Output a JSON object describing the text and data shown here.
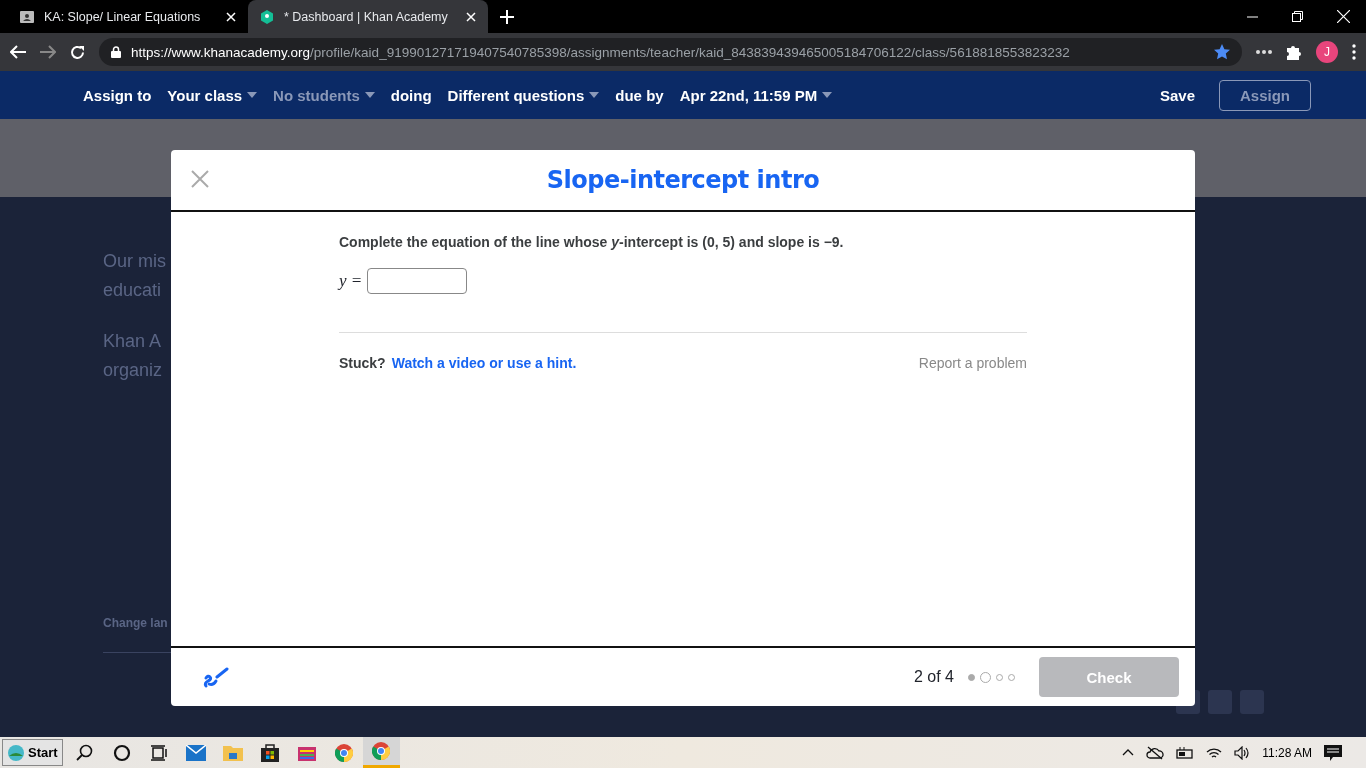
{
  "browser": {
    "tabs": [
      {
        "title": "KA: Slope/ Linear Equations",
        "selected": false
      },
      {
        "title": "* Dashboard | Khan Academy",
        "selected": true
      }
    ],
    "url_host": "https://www.khanacademy.org",
    "url_path": "/profile/kaid_919901271719407540785398/assignments/teacher/kaid_843839439465005184706122/class/5618818553823232",
    "bookmarked": true,
    "profile_initial": "J"
  },
  "assign_bar": {
    "items": [
      {
        "kind": "label",
        "text": "Assign to",
        "disabled": false
      },
      {
        "kind": "dropdown",
        "text": "Your class",
        "disabled": false
      },
      {
        "kind": "dropdown",
        "text": "No students",
        "disabled": true
      },
      {
        "kind": "label",
        "text": "doing",
        "disabled": false
      },
      {
        "kind": "dropdown",
        "text": "Different questions",
        "disabled": false
      },
      {
        "kind": "label",
        "text": "due by",
        "disabled": false
      },
      {
        "kind": "dropdown",
        "text": "Apr 22nd, 11:59 PM",
        "disabled": false
      }
    ],
    "save": "Save",
    "assign": {
      "label": "Assign",
      "disabled": true
    }
  },
  "background_page": {
    "paragraphs": [
      [
        "Our mis",
        "educati"
      ],
      [
        "Khan A",
        "organiz"
      ]
    ],
    "footer_link": "Change lan"
  },
  "modal": {
    "title": "Slope-intercept intro",
    "question": "Complete the equation of the line whose *y*-intercept is (0, 5) and slope is −9.",
    "answer_label": "y =",
    "stuck": "Stuck?",
    "hint_link": "Watch a video or use a hint.",
    "report": "Report a problem",
    "progress": "2 of 4",
    "dots": [
      {
        "completed": true,
        "selected": false
      },
      {
        "completed": false,
        "selected": true
      },
      {
        "completed": false,
        "selected": false
      },
      {
        "completed": false,
        "selected": false
      }
    ],
    "check": {
      "label": "Check",
      "disabled": true
    }
  },
  "taskbar": {
    "start": "Start",
    "apps": [
      {
        "kind": "search",
        "selected": false
      },
      {
        "kind": "cortana",
        "selected": false
      },
      {
        "kind": "taskview",
        "selected": false
      },
      {
        "kind": "mail",
        "selected": false
      },
      {
        "kind": "folder",
        "selected": false
      },
      {
        "kind": "store",
        "selected": false
      },
      {
        "kind": "paint",
        "selected": false
      },
      {
        "kind": "chrome",
        "selected": false
      },
      {
        "kind": "chrome",
        "selected": true
      }
    ],
    "time": "11:28 AM"
  }
}
